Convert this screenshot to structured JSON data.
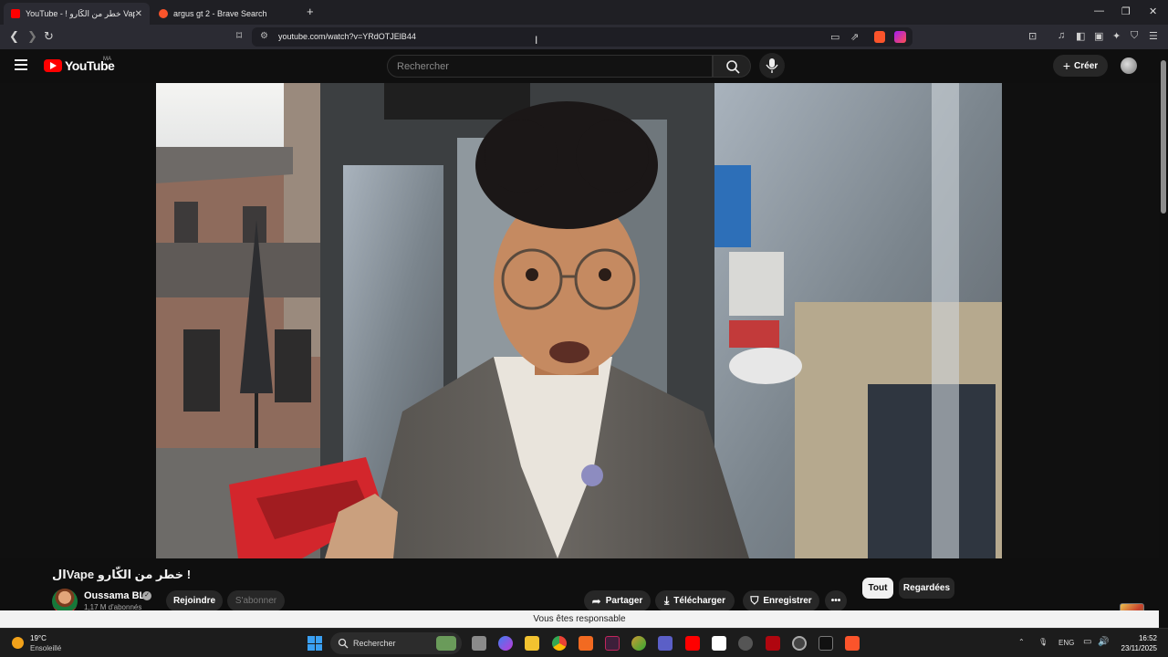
{
  "browser": {
    "tabs": [
      {
        "label": "YouTube - ! خطر من الكّارو Vape ال",
        "active": true
      },
      {
        "label": "argus gt 2 - Brave Search",
        "active": false
      }
    ],
    "new_tab_label": "+",
    "url": "youtube.com/watch?v=YRdOTJElB44"
  },
  "youtube": {
    "logo_text": "YouTube",
    "country": "MA",
    "search_placeholder": "Rechercher",
    "create_label": "Créer"
  },
  "video": {
    "title": "! خطر من الكّارو Vapeال",
    "channel_name": "Oussama BL",
    "subscribers": "1,17 M d'abonnés",
    "join_label": "Rejoindre",
    "subscribe_label": "S'abonner",
    "share_label": "Partager",
    "download_label": "Télécharger",
    "save_label": "Enregistrer",
    "more_label": "•••"
  },
  "chips": {
    "all": "Tout",
    "watched": "Regardées"
  },
  "toast": "Vous êtes responsable",
  "taskbar": {
    "temperature": "19°C",
    "weather": "Ensoleillé",
    "search_label": "Rechercher",
    "language": "ENG",
    "time": "16:52",
    "date": "23/11/2025"
  },
  "colors": {
    "yt_red": "#ff0000",
    "background": "#0f0f0f"
  }
}
